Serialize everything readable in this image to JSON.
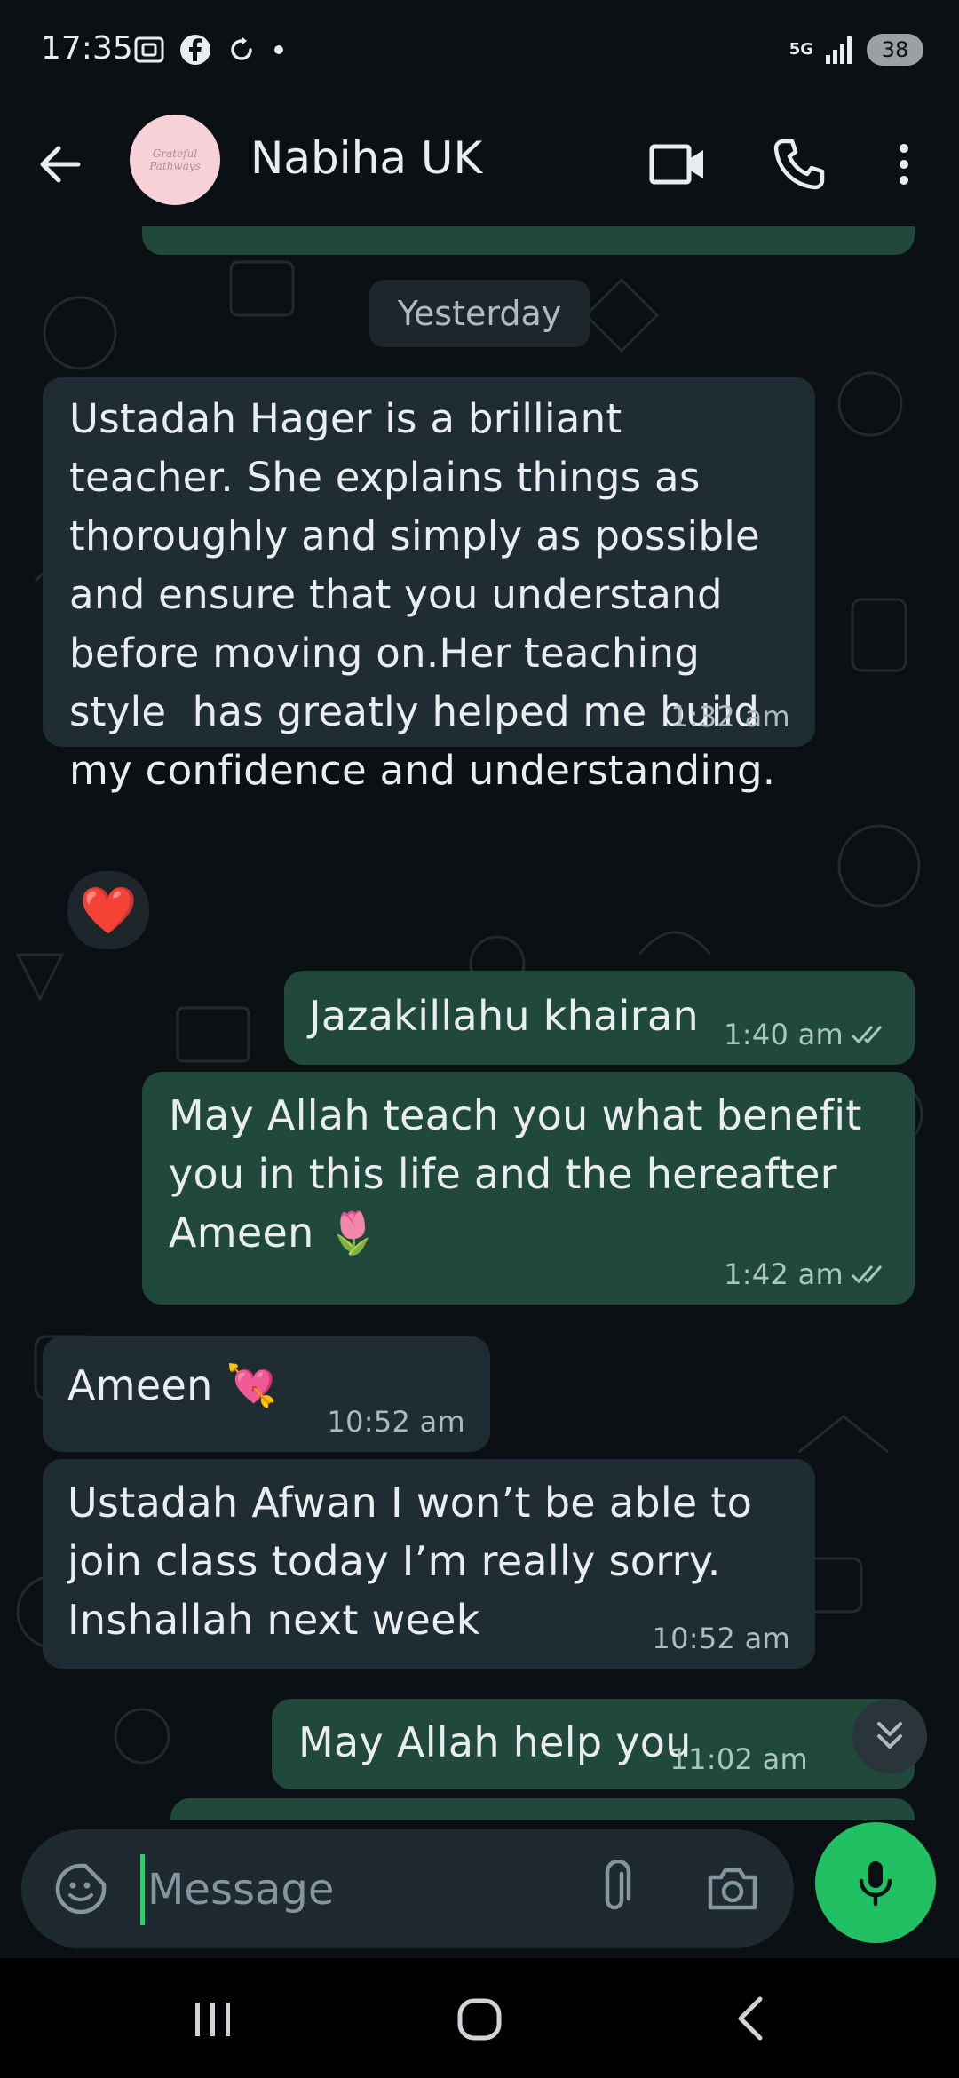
{
  "status_bar": {
    "time": "17:35",
    "network": "5G",
    "battery": "38"
  },
  "header": {
    "contact_name": "Nabiha UK",
    "avatar_text": "Grateful Pathways"
  },
  "chat": {
    "date_separator": "Yesterday",
    "messages": [
      {
        "direction": "in",
        "text": "Ustadah Hager is a brilliant teacher. She explains things as thoroughly and simply as possible and ensure that you understand before moving on.Her teaching style  has greatly helped me build my confidence and understanding.",
        "time": "1:32 am"
      },
      {
        "direction": "out",
        "text": "Jazakillahu khairan",
        "time": "1:40 am"
      },
      {
        "direction": "out",
        "text": "May Allah teach you what benefit you in this life and the hereafter Ameen 🌷",
        "time": "1:42 am"
      },
      {
        "direction": "in",
        "text": "Ameen 💘",
        "time": "10:52 am"
      },
      {
        "direction": "in",
        "text": "Ustadah Afwan I won’t be able to join class today I’m really sorry. Inshallah next week",
        "time": "10:52 am"
      },
      {
        "direction": "out",
        "text": "May Allah help you",
        "time": "11:02 am"
      }
    ],
    "reaction": "❤️"
  },
  "composer": {
    "placeholder": "Message"
  },
  "colors": {
    "background": "#0b1014",
    "incoming_bubble": "#202c33",
    "outgoing_bubble": "#21493b",
    "accent_green": "#21c063",
    "read_ticks": "#a9c7b9"
  }
}
